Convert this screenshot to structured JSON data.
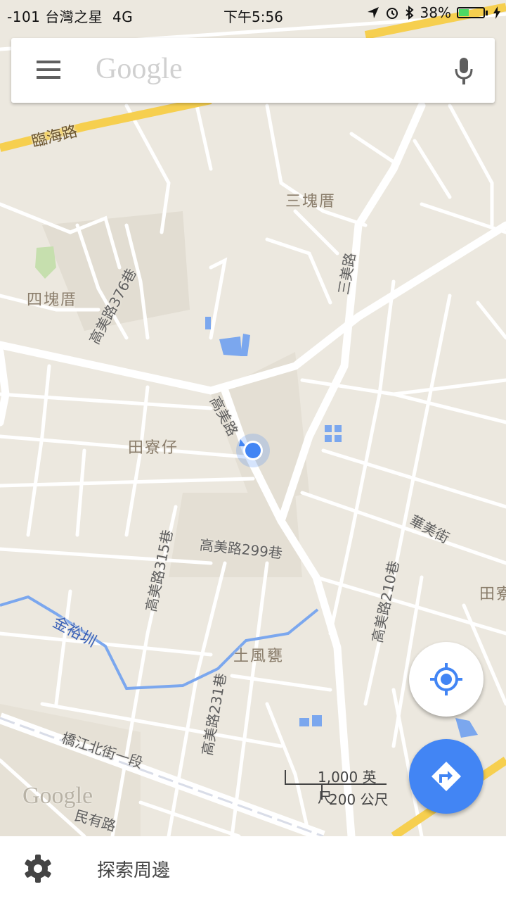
{
  "status_bar": {
    "carrier": "-101 台灣之星",
    "network": "4G",
    "time": "下午5:56",
    "battery": "38%"
  },
  "search": {
    "placeholder": "Google"
  },
  "map": {
    "labels": {
      "linhai": "臨海路",
      "sankuaicuo": "三塊厝",
      "sankuaicuo_prefix": "三",
      "sikuaicuo": "四塊厝",
      "gaomei376": "高美路376巷",
      "sanmei": "三美路",
      "gaomei": "高美路",
      "tianliaozai": "田寮仔",
      "huamei": "華美街",
      "gaomei299": "高美路299巷",
      "gaomei315": "高美路315巷",
      "gaomei210": "高美路210巷",
      "tian_edge": "田寮",
      "jinyuzun": "金裕圳",
      "tufengjiao": "土風甕",
      "gaomei231": "高美路231巷",
      "qiaojiang": "橋江北街一段",
      "minyou": "民有路"
    },
    "scale": {
      "imperial": "1,000 英尺",
      "metric": "200 公尺"
    },
    "watermark": "Google",
    "colors": {
      "land": "#ece8df",
      "road": "#ffffff",
      "highway": "#f6cf4f",
      "water": "#7ba7ee",
      "location": "#4285f4"
    }
  },
  "bottom_bar": {
    "explore_label": "探索周邊"
  }
}
